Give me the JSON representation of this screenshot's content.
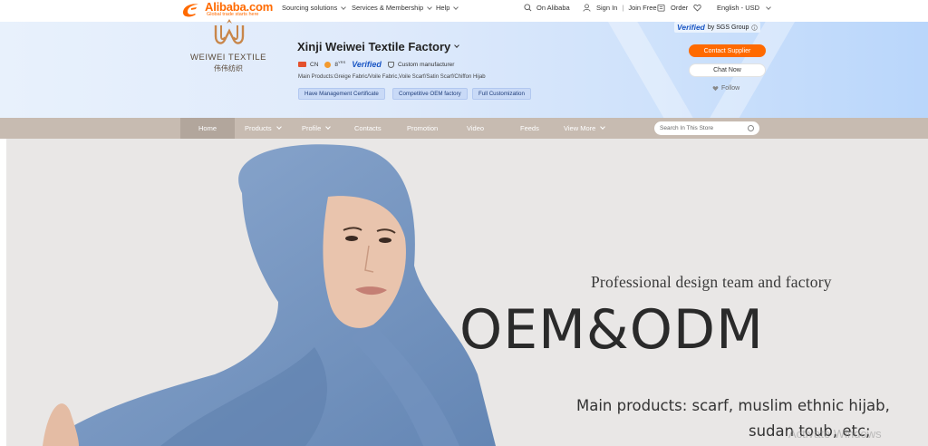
{
  "topbar": {
    "logo_text": "Alibaba.com",
    "logo_tagline": "Global trade starts here",
    "nav": {
      "sourcing": "Sourcing solutions",
      "services": "Services & Membership",
      "help": "Help"
    },
    "on_alibaba": "On Alibaba",
    "sign_in": "Sign In",
    "join_free": "Join Free",
    "order": "Order",
    "locale": "English - USD"
  },
  "supplier": {
    "brand_name": "WEIWEI TEXTILE",
    "brand_cn": "伟伟纺织",
    "company_name": "Xinji Weiwei Textile Factory",
    "country": "CN",
    "years": "8",
    "years_unit": "YRS",
    "verified_label": "Verified",
    "custom_label": "Custom manufacturer",
    "main_products": "Main Products:Greige Fabric/Voile Fabric,Voile Scarf/Satin Scarf/Chiffon Hijab",
    "tags": [
      "Have Management Certificate",
      "Competitive OEM factory",
      "Full Customization"
    ],
    "sgs_verified": "Verified",
    "sgs_by": "by SGS Group",
    "contact_button": "Contact Supplier",
    "chat_button": "Chat Now",
    "follow_button": "Follow"
  },
  "store_nav": {
    "items": [
      "Home",
      "Products",
      "Profile",
      "Contacts",
      "Promotion",
      "Video",
      "Feeds",
      "View More"
    ],
    "search_placeholder": "Search In This Store"
  },
  "banner": {
    "subtitle": "Professional design team and factory",
    "title": "OEM&ODM",
    "line1": "Main products: scarf, muslim ethnic hijab,",
    "line2": "sudan toub, etc;"
  },
  "os_watermark": "Activate Windows",
  "colors": {
    "alibaba_orange": "#ff6a00",
    "verified_blue": "#1a56c4",
    "hijab_blue": "#7c9cc4"
  }
}
